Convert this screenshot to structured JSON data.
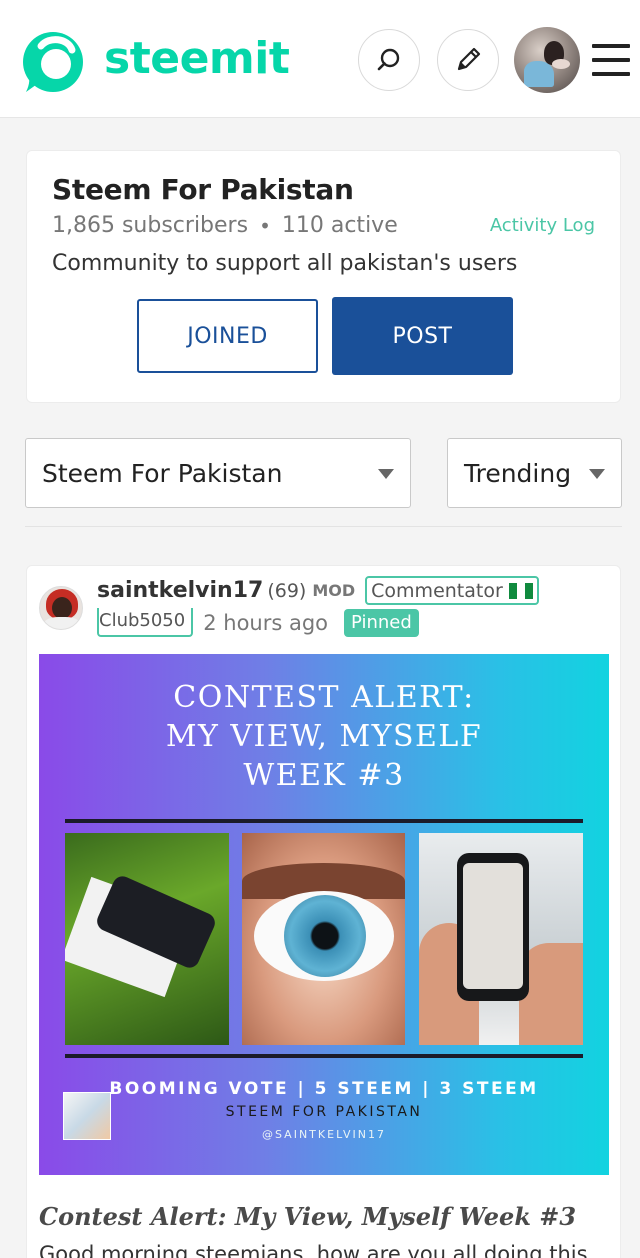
{
  "header": {
    "brand": "steemit",
    "brand_color": "#06d6a9",
    "icons": [
      "logo-icon",
      "search-icon",
      "pencil-icon",
      "avatar",
      "hamburger-menu-icon"
    ]
  },
  "community": {
    "name": "Steem For Pakistan",
    "subscribers": "1,865 subscribers",
    "active": "110 active",
    "activity_log": "Activity Log",
    "description": "Community to support all pakistan's users",
    "joined_label": "JOINED",
    "post_label": "POST",
    "accent": "#1a5099"
  },
  "filters": {
    "community_selected": "Steem For Pakistan",
    "sort_selected": "Trending"
  },
  "post": {
    "author": "saintkelvin17",
    "reputation": "(69)",
    "role": "MOD",
    "author_title": "Commentator",
    "club": "Club5050",
    "time": "2 hours ago",
    "pinned": "Pinned",
    "image": {
      "heading_1": "CONTEST ALERT:",
      "heading_2": "MY VIEW, MYSELF",
      "heading_3": "WEEK #3",
      "footer_1": "BOOMING VOTE | 5 STEEM | 3 STEEM",
      "footer_2": "STEEM FOR PAKISTAN",
      "footer_3": "@SAINTKELVIN17"
    },
    "title": "Contest Alert: My View, Myself Week #3",
    "body_preview": "Good morning steemians, how are you all doing this"
  }
}
